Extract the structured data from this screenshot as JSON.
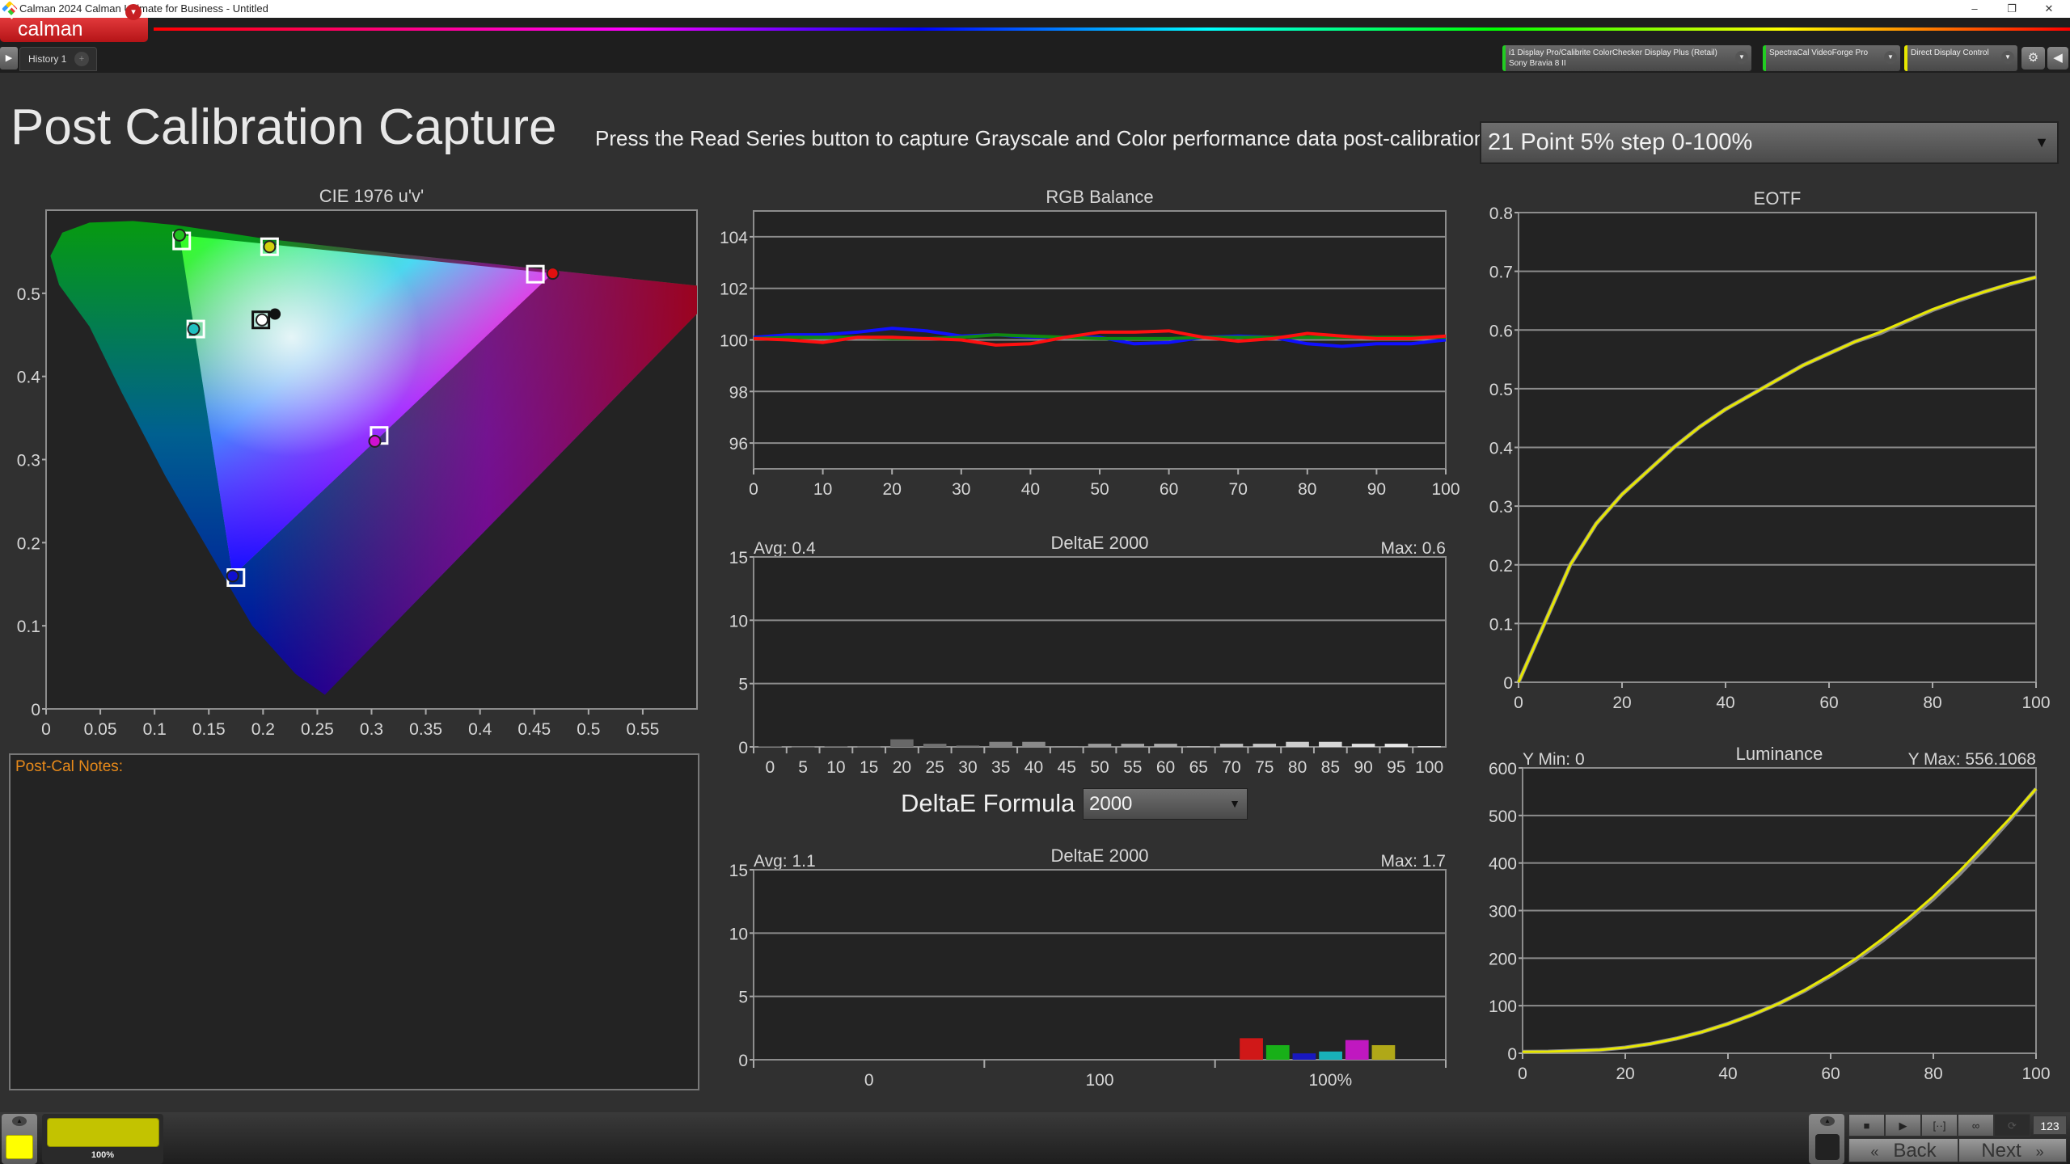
{
  "window": {
    "title": "Calman 2024 Calman Ultimate for Business  - Untitled",
    "minimize": "–",
    "restore": "❐",
    "close": "✕"
  },
  "app": {
    "logo": "calman",
    "menu_caret": "▾",
    "play": "▶",
    "history_tab": "History 1",
    "add_tab": "+"
  },
  "devices": [
    {
      "line1": "i1 Display Pro/Calibrite ColorChecker Display Plus (Retail)",
      "line2": "Sony Bravia 8 II",
      "status_color": "#22cc22"
    },
    {
      "line1": "SpectraCal VideoForge Pro",
      "line2": "",
      "status_color": "#22cc22"
    },
    {
      "line1": "Direct Display Control",
      "line2": "",
      "status_color": "#e8e800"
    }
  ],
  "toolbar": {
    "settings_icon": "gear-icon",
    "settings": "⚙",
    "collapse": "◀"
  },
  "page": {
    "title": "Post Calibration Capture",
    "instruction": "Press the Read Series button to capture Grayscale and Color performance data post-calibration.",
    "series_dropdown": "21 Point 5% step 0-100%",
    "dropdown_arrow": "▼"
  },
  "notes": {
    "label": "Post-Cal Notes:",
    "value": ""
  },
  "delta_formula": {
    "label": "DeltaE Formula",
    "value": "2000"
  },
  "bottom": {
    "swatch_color": "#c3c300",
    "swatch_percent": "100%",
    "stop": "■",
    "play": "▶",
    "range": "[··]",
    "loop": "∞",
    "sync": "⟳",
    "back": "Back",
    "next": "Next",
    "back_icon": "«",
    "next_icon": "»",
    "counter": "123"
  },
  "chart_data": [
    {
      "type": "scatter",
      "title": "CIE 1976 u'v'",
      "xlim": [
        0,
        0.6
      ],
      "ylim": [
        0,
        0.6
      ],
      "xticks": [
        "0",
        "0.05",
        "0.1",
        "0.15",
        "0.2",
        "0.25",
        "0.3",
        "0.35",
        "0.4",
        "0.45",
        "0.5",
        "0.55"
      ],
      "yticks": [
        "0",
        "0.1",
        "0.2",
        "0.3",
        "0.4",
        "0.5"
      ],
      "points": [
        {
          "color": "#e01010",
          "target": [
            0.451,
            0.523
          ],
          "measured": [
            0.467,
            0.524
          ]
        },
        {
          "color": "#20c020",
          "target": [
            0.125,
            0.563
          ],
          "measured": [
            0.123,
            0.57
          ]
        },
        {
          "color": "#1010d0",
          "target": [
            0.175,
            0.158
          ],
          "measured": [
            0.172,
            0.16
          ]
        },
        {
          "color": "#20c0c0",
          "target": [
            0.138,
            0.457
          ],
          "measured": [
            0.136,
            0.457
          ]
        },
        {
          "color": "#d010d0",
          "target": [
            0.307,
            0.329
          ],
          "measured": [
            0.303,
            0.322
          ]
        },
        {
          "color": "#d0d010",
          "target": [
            0.206,
            0.556
          ],
          "measured": [
            0.206,
            0.556
          ]
        },
        {
          "color": "#ffffff",
          "target": [
            0.198,
            0.468
          ],
          "measured": [
            0.199,
            0.468
          ]
        }
      ],
      "reference_point": [
        0.211,
        0.475
      ]
    },
    {
      "type": "line",
      "title": "RGB Balance",
      "xlim": [
        0,
        100
      ],
      "ylim": [
        95,
        105
      ],
      "xticks": [
        "0",
        "10",
        "20",
        "30",
        "40",
        "50",
        "60",
        "70",
        "80",
        "90",
        "100"
      ],
      "yticks": [
        "96",
        "98",
        "100",
        "102",
        "104"
      ],
      "x": [
        0,
        5,
        10,
        15,
        20,
        25,
        30,
        35,
        40,
        45,
        50,
        55,
        60,
        65,
        70,
        75,
        80,
        85,
        90,
        95,
        100
      ],
      "series": [
        {
          "color": "#ff1010",
          "values": [
            100.05,
            100.0,
            99.9,
            100.1,
            100.1,
            100.05,
            100.0,
            99.8,
            99.85,
            100.1,
            100.3,
            100.3,
            100.35,
            100.1,
            99.95,
            100.05,
            100.25,
            100.15,
            100.05,
            100.05,
            100.15
          ]
        },
        {
          "color": "#108a10",
          "values": [
            100.05,
            100.1,
            100.1,
            100.1,
            100.05,
            100.05,
            100.1,
            100.2,
            100.15,
            100.1,
            100.05,
            100.05,
            100.05,
            100.1,
            100.1,
            100.1,
            100.1,
            100.1,
            100.1,
            100.1,
            100.1
          ]
        },
        {
          "color": "#1010ff",
          "values": [
            100.1,
            100.2,
            100.2,
            100.3,
            100.45,
            100.35,
            100.15,
            100.2,
            100.1,
            100.1,
            100.1,
            99.85,
            99.9,
            100.1,
            100.15,
            100.1,
            99.85,
            99.75,
            99.85,
            99.85,
            100.0
          ]
        }
      ]
    },
    {
      "type": "bar",
      "title": "DeltaE 2000",
      "avg": "Avg: 0.4",
      "max": "Max: 0.6",
      "ylim": [
        0,
        15
      ],
      "yticks": [
        "0",
        "5",
        "10",
        "15"
      ],
      "categories": [
        "0",
        "5",
        "10",
        "15",
        "20",
        "25",
        "30",
        "35",
        "40",
        "45",
        "50",
        "55",
        "60",
        "65",
        "70",
        "75",
        "80",
        "85",
        "90",
        "95",
        "100"
      ],
      "values": [
        0.05,
        0.02,
        0.05,
        0.03,
        0.6,
        0.25,
        0.1,
        0.4,
        0.4,
        0.05,
        0.25,
        0.25,
        0.25,
        0.05,
        0.25,
        0.25,
        0.4,
        0.4,
        0.25,
        0.25,
        0.05
      ]
    },
    {
      "type": "bar",
      "title": "DeltaE 2000",
      "avg": "Avg: 1.1",
      "max": "Max: 1.7",
      "ylim": [
        0,
        15
      ],
      "yticks": [
        "0",
        "5",
        "10",
        "15"
      ],
      "categories": [
        "0",
        "100",
        "100%"
      ],
      "groups": [
        [],
        [],
        [
          {
            "color": "#d01818",
            "value": 1.7
          },
          {
            "color": "#18b018",
            "value": 1.15
          },
          {
            "color": "#1818c0",
            "value": 0.5
          },
          {
            "color": "#18b0b8",
            "value": 0.65
          },
          {
            "color": "#c018c0",
            "value": 1.55
          },
          {
            "color": "#b0a818",
            "value": 1.15
          }
        ]
      ]
    },
    {
      "type": "line",
      "title": "EOTF",
      "xlim": [
        0,
        100
      ],
      "ylim": [
        0,
        0.8
      ],
      "xticks": [
        "0",
        "20",
        "40",
        "60",
        "80",
        "100"
      ],
      "yticks": [
        "0",
        "0.1",
        "0.2",
        "0.3",
        "0.4",
        "0.5",
        "0.6",
        "0.7",
        "0.8"
      ],
      "x": [
        0,
        5,
        10,
        15,
        20,
        25,
        30,
        35,
        40,
        45,
        50,
        55,
        60,
        65,
        70,
        75,
        80,
        85,
        90,
        95,
        100
      ],
      "series": [
        {
          "color": "#e8e800",
          "values": [
            0,
            0.1,
            0.2,
            0.27,
            0.32,
            0.36,
            0.4,
            0.435,
            0.465,
            0.49,
            0.515,
            0.54,
            0.56,
            0.58,
            0.597,
            0.616,
            0.635,
            0.651,
            0.665,
            0.679,
            0.69
          ]
        },
        {
          "color": "#8a8a8a",
          "values": [
            0,
            0.1,
            0.2,
            0.27,
            0.32,
            0.36,
            0.4,
            0.435,
            0.465,
            0.49,
            0.515,
            0.54,
            0.56,
            0.58,
            0.595,
            0.615,
            0.634,
            0.65,
            0.665,
            0.678,
            0.69
          ]
        }
      ]
    },
    {
      "type": "line",
      "title": "Luminance",
      "ymin_label": "Y Min: 0",
      "ymax_label": "Y Max: 556.1068",
      "xlim": [
        0,
        100
      ],
      "ylim": [
        0,
        600
      ],
      "xticks": [
        "0",
        "20",
        "40",
        "60",
        "80",
        "100"
      ],
      "yticks": [
        "0",
        "100",
        "200",
        "300",
        "400",
        "500",
        "600"
      ],
      "x": [
        0,
        5,
        10,
        15,
        20,
        25,
        30,
        35,
        40,
        45,
        50,
        55,
        60,
        65,
        70,
        75,
        80,
        85,
        90,
        95,
        100
      ],
      "series": [
        {
          "color": "#e8e800",
          "values": [
            3,
            3.4,
            5,
            7,
            12,
            20,
            31,
            45,
            62,
            82,
            105,
            133,
            165,
            200,
            240,
            283,
            330,
            382,
            438,
            495,
            556.1
          ]
        },
        {
          "color": "#8a8a8a",
          "values": [
            3,
            3.4,
            5,
            7,
            12,
            20,
            31,
            45,
            62,
            82,
            105,
            132,
            163,
            197,
            236,
            279,
            325,
            376,
            432,
            492,
            556.1
          ]
        }
      ]
    }
  ]
}
